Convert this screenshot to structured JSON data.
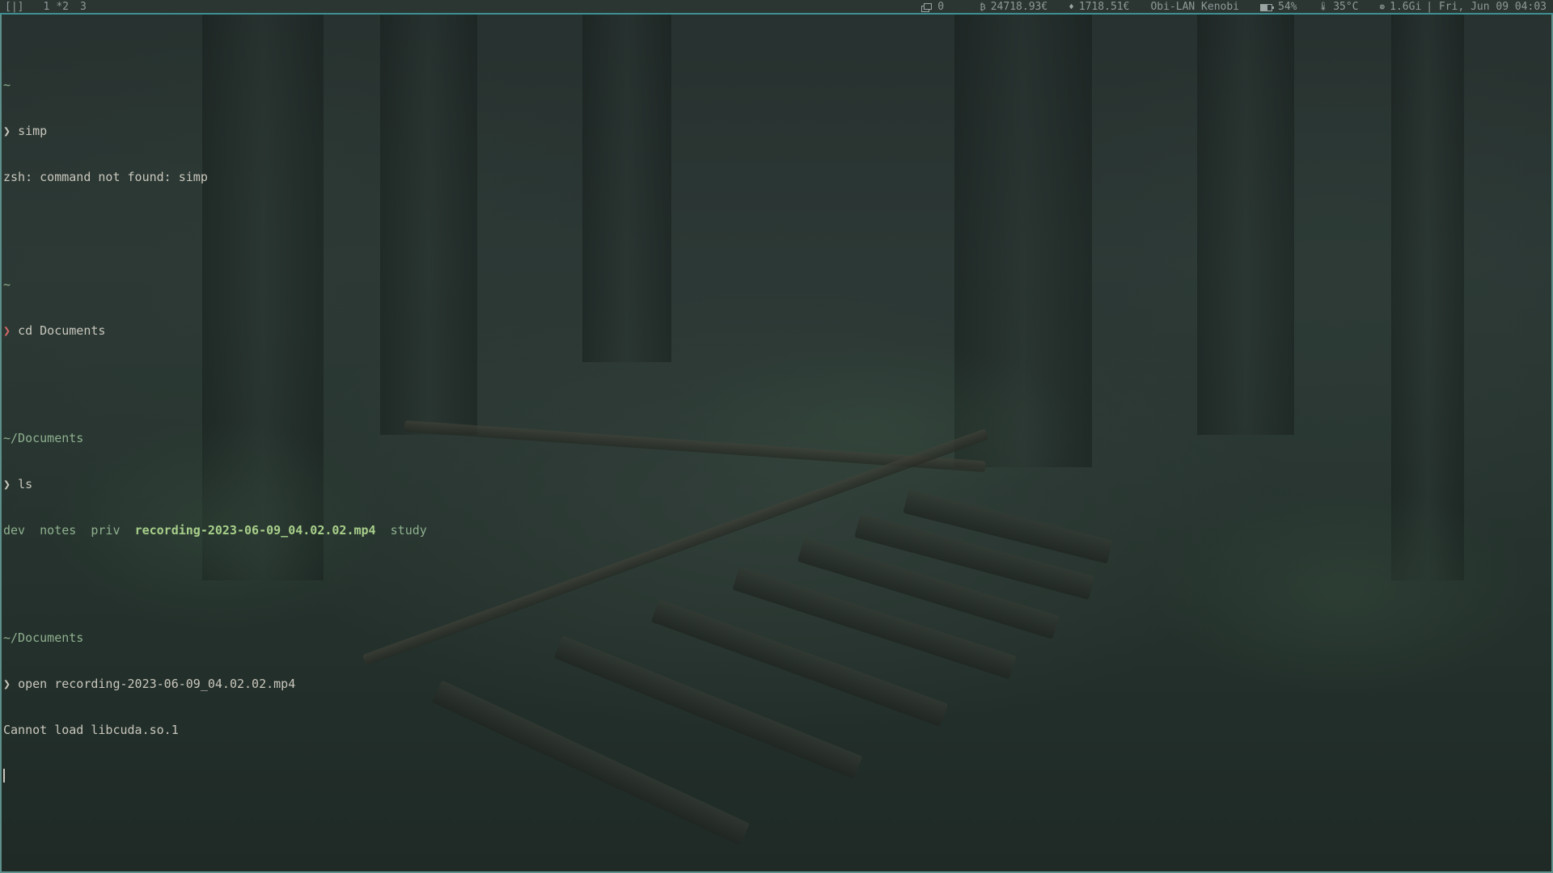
{
  "topbar": {
    "layout_indicator": "[|]",
    "workspaces": [
      "1",
      "*2",
      "3"
    ],
    "windows_count": "0",
    "btc_symbol": "₿",
    "btc_price": "24718.93€",
    "eth_symbol": "♦",
    "eth_price": "1718.51€",
    "network": "Obi-LAN Kenobi",
    "battery": "54%",
    "temp_symbol": "🌡",
    "temperature": "35°C",
    "memory_symbol": "⊛",
    "memory": "1.6Gi",
    "clock": "| Fri, Jun 09 04:03"
  },
  "terminal": {
    "prompt_symbol": "❯",
    "blocks": [
      {
        "cwd": "~",
        "command": "simp",
        "prompt_status": "ok",
        "output": "zsh: command not found: simp"
      },
      {
        "cwd": "~",
        "command": "cd Documents",
        "prompt_status": "error",
        "output": ""
      },
      {
        "cwd": "~/Documents",
        "command": "ls",
        "prompt_status": "ok",
        "ls_entries": [
          {
            "name": "dev",
            "kind": "dir"
          },
          {
            "name": "notes",
            "kind": "dir"
          },
          {
            "name": "priv",
            "kind": "dir"
          },
          {
            "name": "recording-2023-06-09_04.02.02.mp4",
            "kind": "file"
          },
          {
            "name": "study",
            "kind": "dir"
          }
        ]
      },
      {
        "cwd": "~/Documents",
        "command": "open recording-2023-06-09_04.02.02.mp4",
        "prompt_status": "ok",
        "output": "Cannot load libcuda.so.1"
      }
    ]
  },
  "colors": {
    "accent_border": "#3e8f93",
    "prompt_error": "#d46a6a",
    "directory": "#8fb08f"
  }
}
